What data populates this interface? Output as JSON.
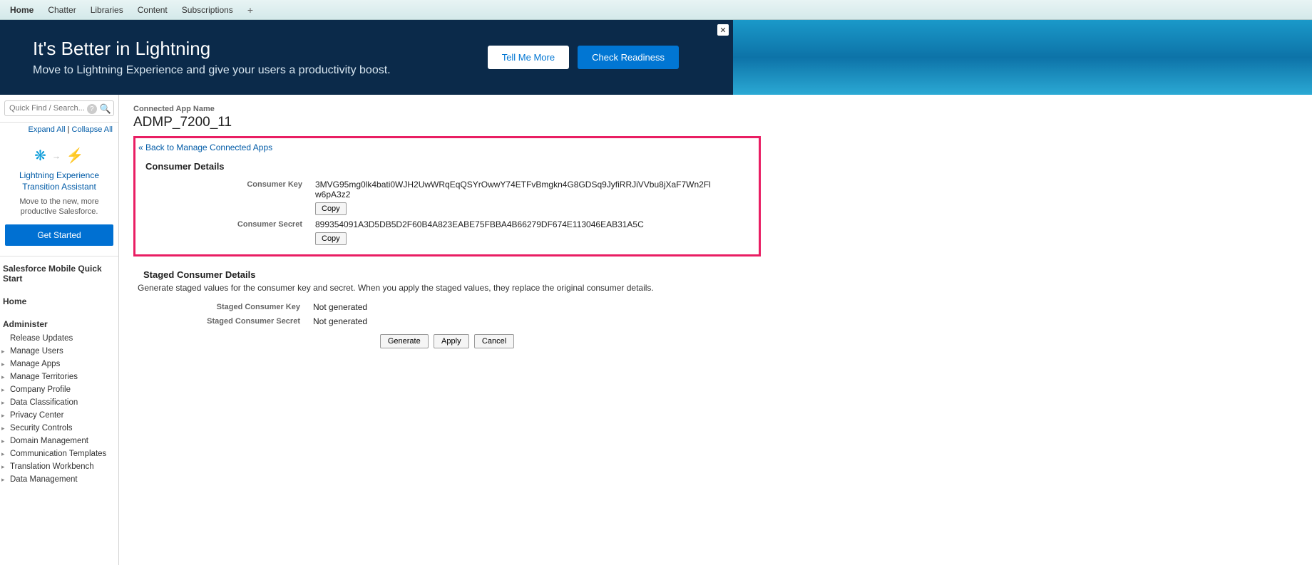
{
  "tabs": {
    "home": "Home",
    "chatter": "Chatter",
    "libraries": "Libraries",
    "content": "Content",
    "subscriptions": "Subscriptions"
  },
  "hero": {
    "title": "It's Better in Lightning",
    "subtitle": "Move to Lightning Experience and give your users a productivity boost.",
    "tell_me_more": "Tell Me More",
    "check_readiness": "Check Readiness"
  },
  "sidebar": {
    "search_placeholder": "Quick Find / Search...",
    "expand_all": "Expand All",
    "collapse_all": "Collapse All",
    "assistant_title": "Lightning Experience Transition Assistant",
    "assistant_desc": "Move to the new, more productive Salesforce.",
    "get_started": "Get Started",
    "mobile_quick": "Salesforce Mobile Quick Start",
    "home_heading": "Home",
    "administer_heading": "Administer",
    "items": {
      "release_updates": "Release Updates",
      "manage_users": "Manage Users",
      "manage_apps": "Manage Apps",
      "manage_territories": "Manage Territories",
      "company_profile": "Company Profile",
      "data_classification": "Data Classification",
      "privacy_center": "Privacy Center",
      "security_controls": "Security Controls",
      "domain_management": "Domain Management",
      "communication_templates": "Communication Templates",
      "translation_workbench": "Translation Workbench",
      "data_management": "Data Management"
    }
  },
  "main": {
    "breadcrumb_label": "Connected App Name",
    "app_name": "ADMP_7200_11",
    "back_link": "« Back to Manage Connected Apps",
    "consumer_details_title": "Consumer Details",
    "consumer_key_label": "Consumer Key",
    "consumer_key_value": "3MVG95mg0lk4bati0WJH2UwWRqEqQSYrOwwY74ETFvBmgkn4G8GDSq9JyfiRRJiVVbu8jXaF7Wn2Flw6pA3z2",
    "consumer_secret_label": "Consumer Secret",
    "consumer_secret_value": "899354091A3D5DB5D2F60B4A823EABE75FBBA4B66279DF674E113046EAB31A5C",
    "copy_label": "Copy",
    "staged_title": "Staged Consumer Details",
    "staged_desc": "Generate staged values for the consumer key and secret. When you apply the staged values, they replace the original consumer details.",
    "staged_key_label": "Staged Consumer Key",
    "staged_key_value": "Not generated",
    "staged_secret_label": "Staged Consumer Secret",
    "staged_secret_value": "Not generated",
    "generate_btn": "Generate",
    "apply_btn": "Apply",
    "cancel_btn": "Cancel"
  }
}
